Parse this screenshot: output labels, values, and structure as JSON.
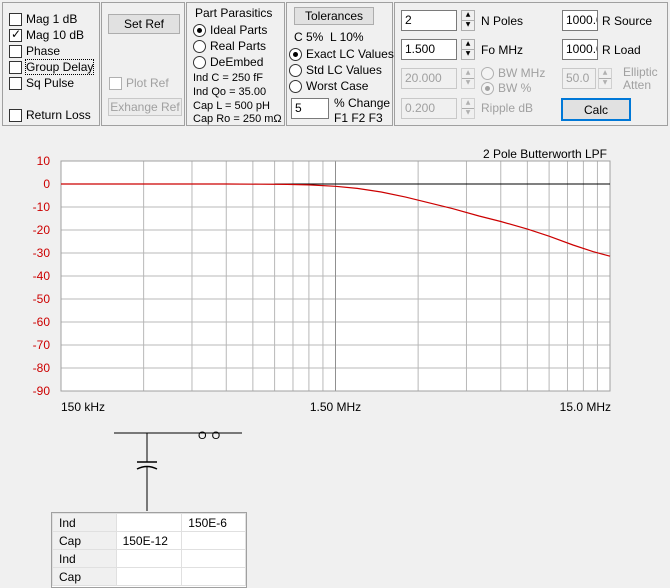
{
  "display_options": {
    "mag_1db": "Mag  1 dB",
    "mag_10db": "Mag 10 dB",
    "phase": "Phase",
    "group_delay": "Group Delay",
    "sq_pulse": "Sq Pulse",
    "return_loss": "Return Loss"
  },
  "reference": {
    "set_ref": "Set Ref",
    "plot_ref": "Plot Ref",
    "exchange_ref": "Exhange Ref"
  },
  "parasitics": {
    "title": "Part Parasitics",
    "ideal": "Ideal Parts",
    "real": "Real Parts",
    "deembed": "DeEmbed",
    "ind_c": "Ind C  =  250 fF",
    "ind_qo": "Ind Qo =  35.00",
    "cap_l": "Cap L  =  500 pH",
    "cap_ro": "Cap Ro = 250 mΩ"
  },
  "tolerances": {
    "button": "Tolerances",
    "c_pct": "C 5%",
    "l_pct": "L 10%",
    "exact": "Exact LC Values",
    "std": "Std LC Values",
    "worst": "Worst Case",
    "change_value": "5",
    "change_label": "% Change",
    "freqs": "F1 F2 F3"
  },
  "design": {
    "n_poles_value": "2",
    "n_poles_label": "N Poles",
    "fo_value": "1.500",
    "fo_label": "Fo  MHz",
    "bw_value": "20.000",
    "bw_mhz": "BW MHz",
    "bw_pct": "BW %",
    "ripple_value": "0.200",
    "ripple_label": "Ripple  dB",
    "r_source_value": "1000.0",
    "r_source_label": "R Source",
    "r_load_value": "1000.0",
    "r_load_label": "R Load",
    "elliptic_value": "50.0",
    "elliptic_label1": "Elliptic",
    "elliptic_label2": "Atten",
    "calc": "Calc"
  },
  "chart_data": {
    "type": "line",
    "title": "2 Pole Butterworth LPF",
    "x_scale": "log",
    "xlim": [
      0.15,
      15.0
    ],
    "ylim": [
      -90,
      10
    ],
    "y_ticks": [
      "10",
      "0",
      "-10",
      "-20",
      "-30",
      "-40",
      "-50",
      "-60",
      "-70",
      "-80",
      "-90"
    ],
    "x_tick_labels": [
      "150 kHz",
      "1.50 MHz",
      "15.0 MHz"
    ],
    "grid": true,
    "colors": {
      "trace": "#cc0000",
      "ref": "#000000",
      "ytick": "#cc0000"
    },
    "series": [
      {
        "values_x": [
          0.15,
          0.3,
          0.6,
          0.8,
          1.0,
          1.2,
          1.5,
          1.8,
          2.2,
          2.7,
          3.3,
          4.0,
          5.0,
          6.0,
          7.5,
          9.0,
          11.0,
          13.0,
          15.0
        ],
        "values_y": [
          0,
          0,
          -0.01,
          -0.07,
          -0.17,
          -0.4,
          -1.0,
          -1.9,
          -3.5,
          -5.7,
          -8.2,
          -10.7,
          -13.9,
          -16.3,
          -19.6,
          -22.7,
          -26.5,
          -29.4,
          -31.4
        ]
      },
      {
        "values_x": [
          0.9,
          2.0,
          4.0,
          8.0,
          15.0
        ],
        "values_y": [
          0,
          0,
          0,
          0,
          0
        ]
      }
    ]
  },
  "schematic": {
    "coupling_label": "O O",
    "table": [
      [
        "Ind",
        "",
        "150E-6"
      ],
      [
        "Cap",
        "150E-12",
        ""
      ],
      [
        "Ind",
        "",
        ""
      ],
      [
        "Cap",
        "",
        ""
      ]
    ]
  }
}
